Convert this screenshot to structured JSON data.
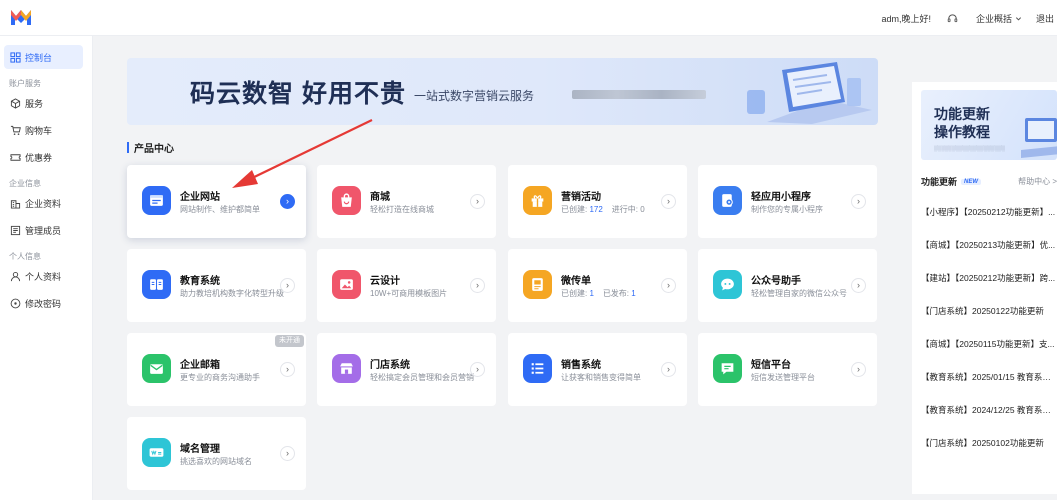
{
  "header": {
    "greeting": "adm,晚上好!",
    "overview": "企业概括",
    "logout": "退出"
  },
  "sidebar": {
    "dashboard": "控制台",
    "group_account": "账户服务",
    "services": "服务",
    "cart": "购物车",
    "coupons": "优惠券",
    "group_company": "企业信息",
    "company_profile": "企业资料",
    "members": "管理成员",
    "group_personal": "个人信息",
    "personal_profile": "个人资料",
    "change_password": "修改密码"
  },
  "banner": {
    "headline": "码云数智  好用不贵",
    "subline": "一站式数字营销云服务"
  },
  "section": {
    "title": "产品中心"
  },
  "products": [
    {
      "title": "企业网站",
      "desc": "网站制作、维护都简单"
    },
    {
      "title": "商城",
      "desc": "轻松打造在线商城"
    },
    {
      "title": "营销活动",
      "desc_created_label": "已创建:",
      "created": "172",
      "desc_progress_label": "进行中:",
      "progress": "0"
    },
    {
      "title": "轻应用小程序",
      "desc": "制作您的专属小程序"
    },
    {
      "title": "教育系统",
      "desc": "助力教培机构数字化转型升级"
    },
    {
      "title": "云设计",
      "desc": "10W+可商用模板图片"
    },
    {
      "title": "微传单",
      "desc_created_label": "已创建:",
      "created": "1",
      "desc_published_label": "已发布:",
      "published": "1"
    },
    {
      "title": "公众号助手",
      "desc": "轻松管理自家的微信公众号"
    },
    {
      "title": "企业邮箱",
      "desc": "更专业的商务沟通助手",
      "badge": "未开通"
    },
    {
      "title": "门店系统",
      "desc": "轻松搞定会员管理和会员营销"
    },
    {
      "title": "销售系统",
      "desc": "让获客和销售变得简单"
    },
    {
      "title": "短信平台",
      "desc": "短信发送管理平台"
    },
    {
      "title": "域名管理",
      "desc": "挑选喜欢的网站域名"
    }
  ],
  "right_panel": {
    "promo_line1": "功能更新",
    "promo_line2": "操作教程",
    "section_label": "功能更新",
    "new_badge": "NEW",
    "help_link": "帮助中心 >",
    "news": [
      "【小程序】【20250212功能更新】...",
      "【商城】【20250213功能更新】优...",
      "【建站】【20250212功能更新】跨...",
      "【门店系统】20250122功能更新",
      "【商城】【20250115功能更新】支...",
      "【教育系统】2025/01/15 教育系统...",
      "【教育系统】2024/12/25 教育系统...",
      "【门店系统】20250102功能更新"
    ]
  },
  "colors": {
    "accent": "#2f6bf5",
    "card_bg": "#ffffff",
    "page_bg": "#f2f3f5"
  }
}
